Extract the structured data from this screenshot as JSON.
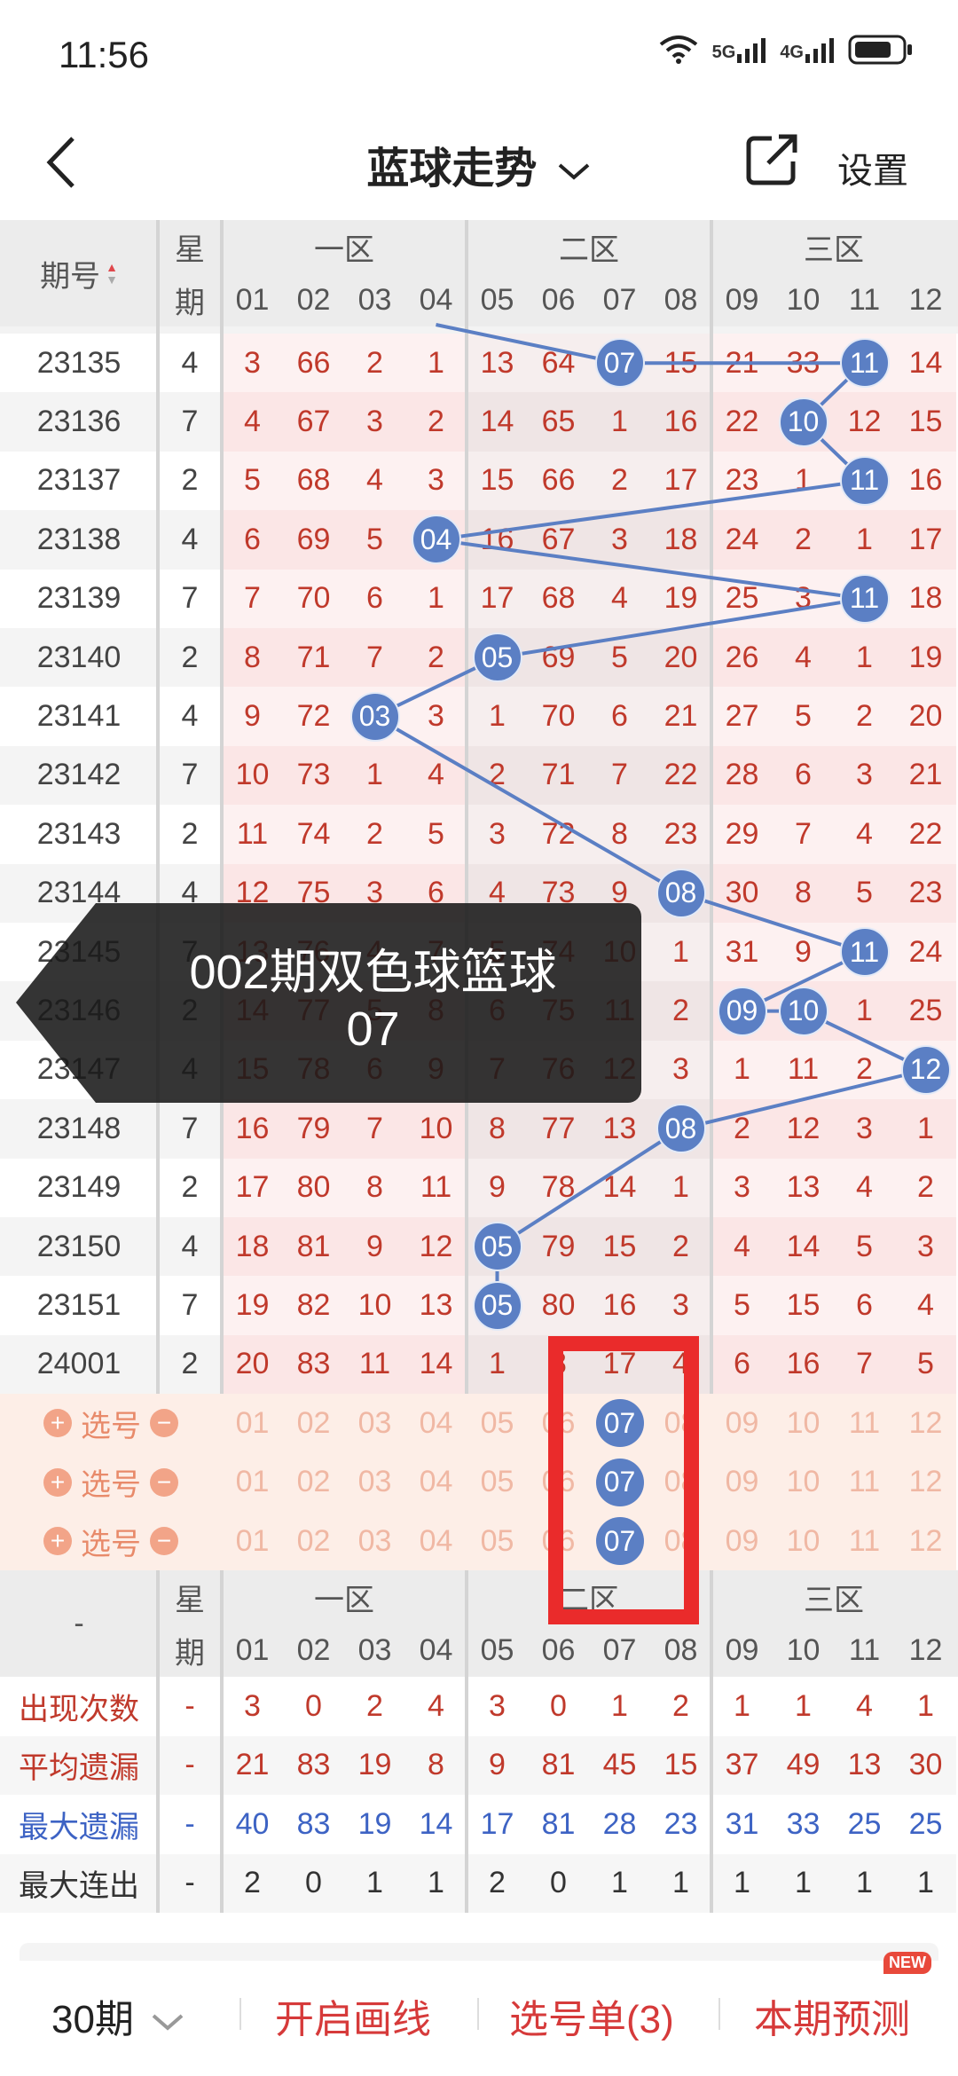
{
  "status": {
    "time": "11:56",
    "net1": "5G",
    "net2": "4G"
  },
  "header": {
    "title": "蓝球走势",
    "settings": "设置"
  },
  "table": {
    "head_period": "期号",
    "head_week_1": "星",
    "head_week_2": "期",
    "zones": [
      "一区",
      "二区",
      "三区"
    ],
    "cols": [
      "01",
      "02",
      "03",
      "04",
      "05",
      "06",
      "07",
      "08",
      "09",
      "10",
      "11",
      "12"
    ],
    "rows": [
      {
        "p": "23135",
        "w": "4",
        "v": [
          "3",
          "66",
          "2",
          "1",
          "13",
          "64",
          "07",
          "15",
          "21",
          "33",
          "11",
          "14"
        ]
      },
      {
        "p": "23136",
        "w": "7",
        "v": [
          "4",
          "67",
          "3",
          "2",
          "14",
          "65",
          "1",
          "16",
          "22",
          "10",
          "12",
          "15"
        ]
      },
      {
        "p": "23137",
        "w": "2",
        "v": [
          "5",
          "68",
          "4",
          "3",
          "15",
          "66",
          "2",
          "17",
          "23",
          "1",
          "11",
          "16"
        ]
      },
      {
        "p": "23138",
        "w": "4",
        "v": [
          "6",
          "69",
          "5",
          "04",
          "16",
          "67",
          "3",
          "18",
          "24",
          "2",
          "1",
          "17"
        ]
      },
      {
        "p": "23139",
        "w": "7",
        "v": [
          "7",
          "70",
          "6",
          "1",
          "17",
          "68",
          "4",
          "19",
          "25",
          "3",
          "11",
          "18"
        ]
      },
      {
        "p": "23140",
        "w": "2",
        "v": [
          "8",
          "71",
          "7",
          "2",
          "05",
          "69",
          "5",
          "20",
          "26",
          "4",
          "1",
          "19"
        ]
      },
      {
        "p": "23141",
        "w": "4",
        "v": [
          "9",
          "72",
          "03",
          "3",
          "1",
          "70",
          "6",
          "21",
          "27",
          "5",
          "2",
          "20"
        ]
      },
      {
        "p": "23142",
        "w": "7",
        "v": [
          "10",
          "73",
          "1",
          "4",
          "2",
          "71",
          "7",
          "22",
          "28",
          "6",
          "3",
          "21"
        ]
      },
      {
        "p": "23143",
        "w": "2",
        "v": [
          "11",
          "74",
          "2",
          "5",
          "3",
          "72",
          "8",
          "23",
          "29",
          "7",
          "4",
          "22"
        ]
      },
      {
        "p": "23144",
        "w": "4",
        "v": [
          "12",
          "75",
          "3",
          "6",
          "4",
          "73",
          "9",
          "08",
          "30",
          "8",
          "5",
          "23"
        ]
      },
      {
        "p": "23145",
        "w": "7",
        "v": [
          "13",
          "76",
          "4",
          "7",
          "5",
          "74",
          "10",
          "1",
          "31",
          "9",
          "11",
          "24"
        ]
      },
      {
        "p": "23146",
        "w": "2",
        "v": [
          "14",
          "77",
          "5",
          "8",
          "6",
          "75",
          "11",
          "2",
          "09",
          "10",
          "1",
          "25"
        ]
      },
      {
        "p": "23147",
        "w": "4",
        "v": [
          "15",
          "78",
          "6",
          "9",
          "7",
          "76",
          "12",
          "3",
          "1",
          "11",
          "2",
          "12"
        ]
      },
      {
        "p": "23148",
        "w": "7",
        "v": [
          "16",
          "79",
          "7",
          "10",
          "8",
          "77",
          "13",
          "08",
          "2",
          "12",
          "3",
          "1"
        ]
      },
      {
        "p": "23149",
        "w": "2",
        "v": [
          "17",
          "80",
          "8",
          "11",
          "9",
          "78",
          "14",
          "1",
          "3",
          "13",
          "4",
          "2"
        ]
      },
      {
        "p": "23150",
        "w": "4",
        "v": [
          "18",
          "81",
          "9",
          "12",
          "05",
          "79",
          "15",
          "2",
          "4",
          "14",
          "5",
          "3"
        ]
      },
      {
        "p": "23151",
        "w": "7",
        "v": [
          "19",
          "82",
          "10",
          "13",
          "05",
          "80",
          "16",
          "3",
          "5",
          "15",
          "6",
          "4"
        ]
      },
      {
        "p": "24001",
        "w": "2",
        "v": [
          "20",
          "83",
          "11",
          "14",
          "1",
          "8",
          "17",
          "4",
          "6",
          "16",
          "7",
          "5"
        ]
      }
    ],
    "pick_label": "选号",
    "pick_selected_col": "07"
  },
  "stats": {
    "head_week_1": "星",
    "head_week_2": "期",
    "dash": "-",
    "rows": [
      {
        "label": "出现次数",
        "dash": "-",
        "v": [
          "3",
          "0",
          "2",
          "4",
          "3",
          "0",
          "1",
          "2",
          "1",
          "1",
          "4",
          "1"
        ],
        "color": "#c0392b"
      },
      {
        "label": "平均遗漏",
        "dash": "-",
        "v": [
          "21",
          "83",
          "19",
          "8",
          "9",
          "81",
          "45",
          "15",
          "37",
          "49",
          "13",
          "30"
        ],
        "color": "#c0392b"
      },
      {
        "label": "最大遗漏",
        "dash": "-",
        "v": [
          "40",
          "83",
          "19",
          "14",
          "17",
          "81",
          "28",
          "23",
          "31",
          "33",
          "25",
          "25"
        ],
        "color": "#3d63c4"
      },
      {
        "label": "最大连出",
        "dash": "-",
        "v": [
          "2",
          "0",
          "1",
          "1",
          "2",
          "0",
          "1",
          "1",
          "1",
          "1",
          "1",
          "1"
        ],
        "color": "#333333"
      }
    ]
  },
  "toast": {
    "line1": "002期双色球篮球",
    "line2": "07"
  },
  "bottom": {
    "period": "30期",
    "draw": "开启画线",
    "picklist": "选号单(3)",
    "predict": "本期预测",
    "badge": "NEW"
  },
  "colors": {
    "ball": "#5b7fc4",
    "red": "#c0392b",
    "blue": "#3d63c4",
    "pinkBg": "#fdecec",
    "highlight": "#ea2b2b"
  }
}
